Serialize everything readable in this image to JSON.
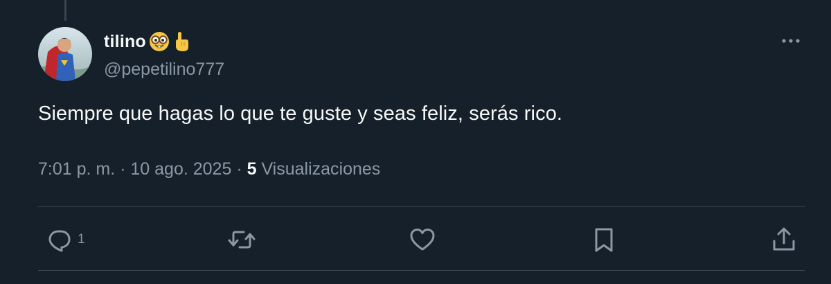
{
  "tweet": {
    "display_name": "tilino",
    "name_emojis": [
      "nerd-face-emoji",
      "pointing-up-emoji"
    ],
    "handle": "@pepetilino777",
    "text": "Siempre que hagas lo que te guste y seas feliz, serás rico.",
    "time": "7:01 p. m.",
    "separator": " · ",
    "date": "10 ago. 2025",
    "views_count": "5",
    "views_label": " Visualizaciones"
  },
  "actions": {
    "reply": {
      "icon": "reply-icon",
      "count": "1"
    },
    "retweet": {
      "icon": "retweet-icon"
    },
    "like": {
      "icon": "heart-icon"
    },
    "bookmark": {
      "icon": "bookmark-icon"
    },
    "share": {
      "icon": "share-icon"
    }
  },
  "colors": {
    "background": "#15202b",
    "text_primary": "#f7f9f9",
    "text_secondary": "#8b98a5",
    "border": "#38444d"
  }
}
